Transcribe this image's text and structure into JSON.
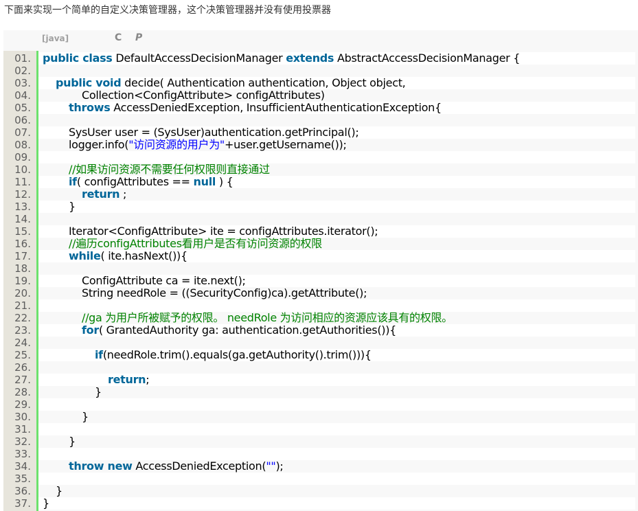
{
  "intro_text": "下面来实现一个简单的自定义决策管理器，这个决策管理器并没有使用投票器",
  "toolbar": {
    "language": "[java]",
    "copy_icon": "C",
    "print_icon": "P"
  },
  "code_lines": [
    {
      "num": "01.",
      "indent": 0,
      "tokens": [
        [
          "kw",
          "public class"
        ],
        [
          "t",
          " DefaultAccessDecisionManager "
        ],
        [
          "kw",
          "extends"
        ],
        [
          "t",
          " AbstractAccessDecisionManager {"
        ]
      ]
    },
    {
      "num": "02.",
      "indent": 0,
      "tokens": []
    },
    {
      "num": "03.",
      "indent": 1,
      "tokens": [
        [
          "kw",
          "public void"
        ],
        [
          "t",
          " decide( Authentication authentication, Object object,"
        ]
      ]
    },
    {
      "num": "04.",
      "indent": 3,
      "tokens": [
        [
          "t",
          "Collection<ConfigAttribute> configAttributes)"
        ]
      ]
    },
    {
      "num": "05.",
      "indent": 2,
      "tokens": [
        [
          "kw",
          "throws"
        ],
        [
          "t",
          " AccessDeniedException, InsufficientAuthenticationException{"
        ]
      ]
    },
    {
      "num": "06.",
      "indent": 0,
      "tokens": []
    },
    {
      "num": "07.",
      "indent": 2,
      "tokens": [
        [
          "t",
          "SysUser user = (SysUser)authentication.getPrincipal();"
        ]
      ]
    },
    {
      "num": "08.",
      "indent": 2,
      "tokens": [
        [
          "t",
          "logger.info("
        ],
        [
          "str",
          "\"访问资源的用户为\""
        ],
        [
          "t",
          "+user.getUsername());"
        ]
      ]
    },
    {
      "num": "09.",
      "indent": 0,
      "tokens": []
    },
    {
      "num": "10.",
      "indent": 2,
      "tokens": [
        [
          "cmt",
          "//如果访问资源不需要任何权限则直接通过"
        ]
      ]
    },
    {
      "num": "11.",
      "indent": 2,
      "tokens": [
        [
          "kw",
          "if"
        ],
        [
          "t",
          "( configAttributes == "
        ],
        [
          "kw",
          "null"
        ],
        [
          "t",
          " ) {"
        ]
      ]
    },
    {
      "num": "12.",
      "indent": 3,
      "tokens": [
        [
          "kw",
          "return"
        ],
        [
          "t",
          " ;"
        ]
      ]
    },
    {
      "num": "13.",
      "indent": 2,
      "tokens": [
        [
          "t",
          "}"
        ]
      ]
    },
    {
      "num": "14.",
      "indent": 0,
      "tokens": []
    },
    {
      "num": "15.",
      "indent": 2,
      "tokens": [
        [
          "t",
          "Iterator<ConfigAttribute> ite = configAttributes.iterator();"
        ]
      ]
    },
    {
      "num": "16.",
      "indent": 2,
      "tokens": [
        [
          "cmt",
          "//遍历configAttributes看用户是否有访问资源的权限"
        ]
      ]
    },
    {
      "num": "17.",
      "indent": 2,
      "tokens": [
        [
          "kw",
          "while"
        ],
        [
          "t",
          "( ite.hasNext()){"
        ]
      ]
    },
    {
      "num": "18.",
      "indent": 0,
      "tokens": []
    },
    {
      "num": "19.",
      "indent": 3,
      "tokens": [
        [
          "t",
          "ConfigAttribute ca = ite.next();"
        ]
      ]
    },
    {
      "num": "20.",
      "indent": 3,
      "tokens": [
        [
          "t",
          "String needRole = ((SecurityConfig)ca).getAttribute();"
        ]
      ]
    },
    {
      "num": "21.",
      "indent": 0,
      "tokens": []
    },
    {
      "num": "22.",
      "indent": 3,
      "tokens": [
        [
          "cmt",
          "//ga 为用户所被赋予的权限。 needRole 为访问相应的资源应该具有的权限。"
        ]
      ]
    },
    {
      "num": "23.",
      "indent": 3,
      "tokens": [
        [
          "kw",
          "for"
        ],
        [
          "t",
          "( GrantedAuthority ga: authentication.getAuthorities()){"
        ]
      ]
    },
    {
      "num": "24.",
      "indent": 0,
      "tokens": []
    },
    {
      "num": "25.",
      "indent": 4,
      "tokens": [
        [
          "kw",
          "if"
        ],
        [
          "t",
          "(needRole.trim().equals(ga.getAuthority().trim())){"
        ]
      ]
    },
    {
      "num": "26.",
      "indent": 0,
      "tokens": []
    },
    {
      "num": "27.",
      "indent": 5,
      "tokens": [
        [
          "kw",
          "return"
        ],
        [
          "t",
          ";"
        ]
      ]
    },
    {
      "num": "28.",
      "indent": 4,
      "tokens": [
        [
          "t",
          "}"
        ]
      ]
    },
    {
      "num": "29.",
      "indent": 0,
      "tokens": []
    },
    {
      "num": "30.",
      "indent": 3,
      "tokens": [
        [
          "t",
          "}"
        ]
      ]
    },
    {
      "num": "31.",
      "indent": 0,
      "tokens": []
    },
    {
      "num": "32.",
      "indent": 2,
      "tokens": [
        [
          "t",
          "}"
        ]
      ]
    },
    {
      "num": "33.",
      "indent": 0,
      "tokens": []
    },
    {
      "num": "34.",
      "indent": 2,
      "tokens": [
        [
          "kw",
          "throw new"
        ],
        [
          "t",
          " AccessDeniedException("
        ],
        [
          "str",
          "\"\""
        ],
        [
          "t",
          ");"
        ]
      ]
    },
    {
      "num": "35.",
      "indent": 0,
      "tokens": []
    },
    {
      "num": "36.",
      "indent": 1,
      "tokens": [
        [
          "t",
          "}"
        ]
      ]
    },
    {
      "num": "37.",
      "indent": 0,
      "tokens": [
        [
          "t",
          "}"
        ]
      ]
    }
  ],
  "colors": {
    "keyword": "#006699",
    "string": "#0000ff",
    "comment": "#008200",
    "gutter_border": "#6ce26c"
  }
}
